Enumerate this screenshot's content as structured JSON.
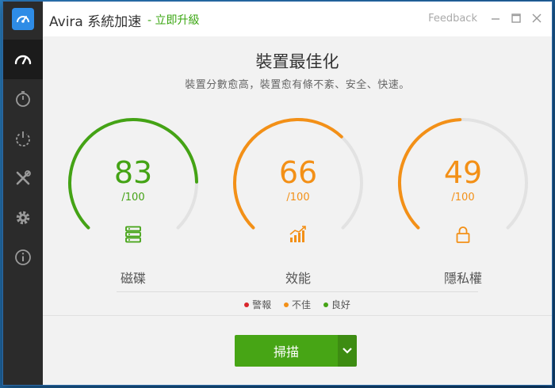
{
  "app": {
    "title": "Avira 系統加速",
    "upgrade_link": "- 立即升級",
    "feedback": "Feedback"
  },
  "header": {
    "title": "裝置最佳化",
    "subtitle": "裝置分數愈高，裝置愈有條不紊、安全、快速。"
  },
  "gauges": [
    {
      "score": "83",
      "denominator": "/100",
      "label": "磁碟",
      "value": 83,
      "color": "#44a315",
      "icon": "disk-icon"
    },
    {
      "score": "66",
      "denominator": "/100",
      "label": "效能",
      "value": 66,
      "color": "#f39017",
      "icon": "performance-icon"
    },
    {
      "score": "49",
      "denominator": "/100",
      "label": "隱私權",
      "value": 49,
      "color": "#f39017",
      "icon": "lock-icon"
    }
  ],
  "legend": [
    {
      "label": "警報",
      "color": "#d9262b"
    },
    {
      "label": "不佳",
      "color": "#f39017"
    },
    {
      "label": "良好",
      "color": "#44a315"
    }
  ],
  "actions": {
    "scan_label": "掃描"
  },
  "sidebar": {
    "items": [
      {
        "icon": "speedometer-icon",
        "active": true
      },
      {
        "icon": "timer-icon",
        "active": false
      },
      {
        "icon": "power-icon",
        "active": false
      },
      {
        "icon": "tools-icon",
        "active": false
      },
      {
        "icon": "gear-icon",
        "active": false
      },
      {
        "icon": "info-icon",
        "active": false
      }
    ]
  },
  "colors": {
    "accent_green": "#44a315",
    "accent_orange": "#f39017",
    "sidebar_bg": "#2b2b2b"
  }
}
